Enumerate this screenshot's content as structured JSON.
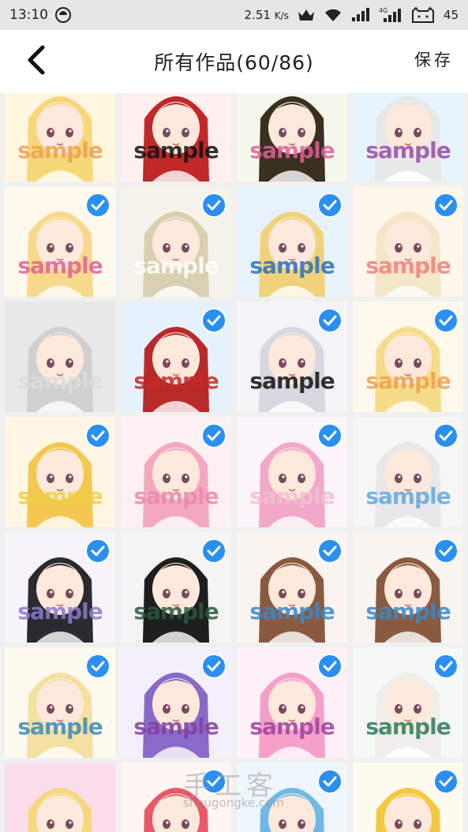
{
  "status_bar": {
    "time": "13:10",
    "speed": "2.51",
    "speed_unit": "K/s",
    "battery": "45",
    "icons": [
      "app-icon",
      "crown-icon",
      "wifi-icon",
      "signal-icon",
      "signal-4g-icon",
      "cat-battery-icon"
    ]
  },
  "header": {
    "title": "所有作品(60/86)",
    "save_label": "保存",
    "back_icon": "back-arrow-icon"
  },
  "watermark_text": "sample",
  "tiles": [
    {
      "selected": false,
      "bg": "#fff6e0",
      "hair": "#f6d77a",
      "mark": "#f0a050"
    },
    {
      "selected": false,
      "bg": "#fff0f0",
      "hair": "#c0282a",
      "mark": "#111111"
    },
    {
      "selected": false,
      "bg": "#f4f8ec",
      "hair": "#3a3020",
      "mark": "#e0609a"
    },
    {
      "selected": false,
      "bg": "#e6f4fb",
      "hair": "#e8e8e8",
      "mark": "#9a4aa8"
    },
    {
      "selected": true,
      "bg": "#fff8ec",
      "hair": "#f6d98a",
      "mark": "#e0609a"
    },
    {
      "selected": true,
      "bg": "#f4f2ea",
      "hair": "#d8d0b0",
      "mark": "#ffffff"
    },
    {
      "selected": true,
      "bg": "#e8f2fb",
      "hair": "#f0d27a",
      "mark": "#2a70c0"
    },
    {
      "selected": true,
      "bg": "#fff6ec",
      "hair": "#f4e6c8",
      "mark": "#f08080"
    },
    {
      "selected": false,
      "bg": "#e8e8e8",
      "hair": "#d0d0d0",
      "mark": "#dddddd"
    },
    {
      "selected": true,
      "bg": "#e6f2fb",
      "hair": "#b82a2a",
      "mark": "#c82828"
    },
    {
      "selected": true,
      "bg": "#f4f4f6",
      "hair": "#d8d8e0",
      "mark": "#111111"
    },
    {
      "selected": true,
      "bg": "#fff8ec",
      "hair": "#f6dc8a",
      "mark": "#f0a050"
    },
    {
      "selected": true,
      "bg": "#fff6e4",
      "hair": "#f2c850",
      "mark": "#f0d040"
    },
    {
      "selected": true,
      "bg": "#fdf0f2",
      "hair": "#f4a8c0",
      "mark": "#e88aa8"
    },
    {
      "selected": true,
      "bg": "#fbf4f8",
      "hair": "#f2a8c8",
      "mark": "#f2c0d0"
    },
    {
      "selected": true,
      "bg": "#f6f6f6",
      "hair": "#e8e8ea",
      "mark": "#60a8e0"
    },
    {
      "selected": true,
      "bg": "#f6f4fa",
      "hair": "#2a2a30",
      "mark": "#8c7cc8"
    },
    {
      "selected": true,
      "bg": "#f4f4f4",
      "hair": "#1e1e1e",
      "mark": "#2c5840"
    },
    {
      "selected": true,
      "bg": "#faf4f0",
      "hair": "#8a5a40",
      "mark": "#3a88c8"
    },
    {
      "selected": true,
      "bg": "#faf4f0",
      "hair": "#8a5a40",
      "mark": "#3a88c8"
    },
    {
      "selected": true,
      "bg": "#fffaf0",
      "hair": "#f4e0a0",
      "mark": "#3a8ab8"
    },
    {
      "selected": true,
      "bg": "#f4f0fb",
      "hair": "#8a6ac8",
      "mark": "#8040a0"
    },
    {
      "selected": true,
      "bg": "#fdf0f6",
      "hair": "#f4a0c8",
      "mark": "#a040a0"
    },
    {
      "selected": true,
      "bg": "#f4f8f6",
      "hair": "#f0eeea",
      "mark": "#2e7a5a"
    },
    {
      "selected": false,
      "bg": "#fbdcea",
      "hair": "#f4d880",
      "mark": "#e0609a"
    },
    {
      "selected": true,
      "bg": "#fff6f4",
      "hair": "#e8586a",
      "mark": "#e0609a"
    },
    {
      "selected": true,
      "bg": "#eef6fb",
      "hair": "#70b8e8",
      "mark": "#2a70c0"
    },
    {
      "selected": true,
      "bg": "#fffaf0",
      "hair": "#f4c840",
      "mark": "#2a70c0"
    }
  ],
  "footer": {
    "brand": "手工客",
    "url": "shougongke.com"
  }
}
